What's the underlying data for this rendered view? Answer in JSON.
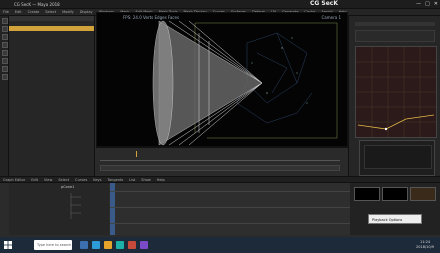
{
  "window": {
    "title": "CG SecK — Maya 2018",
    "brand": "CG SecK",
    "minimize": "—",
    "maximize": "□",
    "close": "✕"
  },
  "menu": [
    "File",
    "Edit",
    "Create",
    "Select",
    "Modify",
    "Display",
    "Windows",
    "Mesh",
    "Edit Mesh",
    "Mesh Tools",
    "Mesh Display",
    "Curves",
    "Surfaces",
    "Deform",
    "UV",
    "Generate",
    "Cache",
    "Arnold",
    "Help"
  ],
  "viewport": {
    "hud": "FPS: 24.0   Verts   Edges   Faces",
    "camera": "Camera 1"
  },
  "bottom_tabs": [
    "Graph Editor",
    "Edit",
    "View",
    "Select",
    "Curves",
    "Keys",
    "Tangents",
    "List",
    "Show",
    "Help"
  ],
  "curve_list_label": "pCone1",
  "tooltip": "Playback Options",
  "taskbar": {
    "search_placeholder": "Type here to search",
    "time": "11:24",
    "date": "2018/10/9"
  },
  "colors": {
    "accent": "#d1a33a",
    "selection": "#d1a33a",
    "taskbar": "#1d2a3a"
  }
}
